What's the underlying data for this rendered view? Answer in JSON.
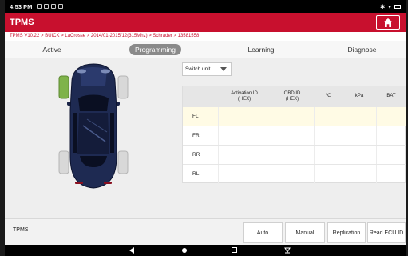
{
  "statusbar": {
    "time": "4:53 PM"
  },
  "app": {
    "title": "TPMS",
    "home_icon": "home-icon"
  },
  "breadcrumb": "TPMS V10.22 > BUICK > LaCrosse > 2014/01-2015/12(315Mhz) > Schrader > 13581558",
  "tabs": [
    {
      "label": "Active",
      "active": false
    },
    {
      "label": "Programming",
      "active": true
    },
    {
      "label": "Learning",
      "active": false
    },
    {
      "label": "Diagnose",
      "active": false
    }
  ],
  "switch_unit": {
    "label": "Switch unit"
  },
  "table": {
    "headers": {
      "activation_l1": "Activation ID",
      "activation_l2": "(HEX)",
      "obd_l1": "OBD ID",
      "obd_l2": "(HEX)",
      "temp": "℃",
      "pressure": "kPa",
      "battery": "BAT"
    },
    "rows": [
      {
        "label": "FL",
        "selected": true
      },
      {
        "label": "FR",
        "selected": false
      },
      {
        "label": "RR",
        "selected": false
      },
      {
        "label": "RL",
        "selected": false
      }
    ]
  },
  "bottom": {
    "title": "TPMS",
    "buttons": [
      "Auto",
      "Manual",
      "Replication",
      "Read ECU ID"
    ]
  },
  "colors": {
    "brand": "#c8102e",
    "car_body": "#1e2a52",
    "selected_tire": "#7fb34a"
  }
}
